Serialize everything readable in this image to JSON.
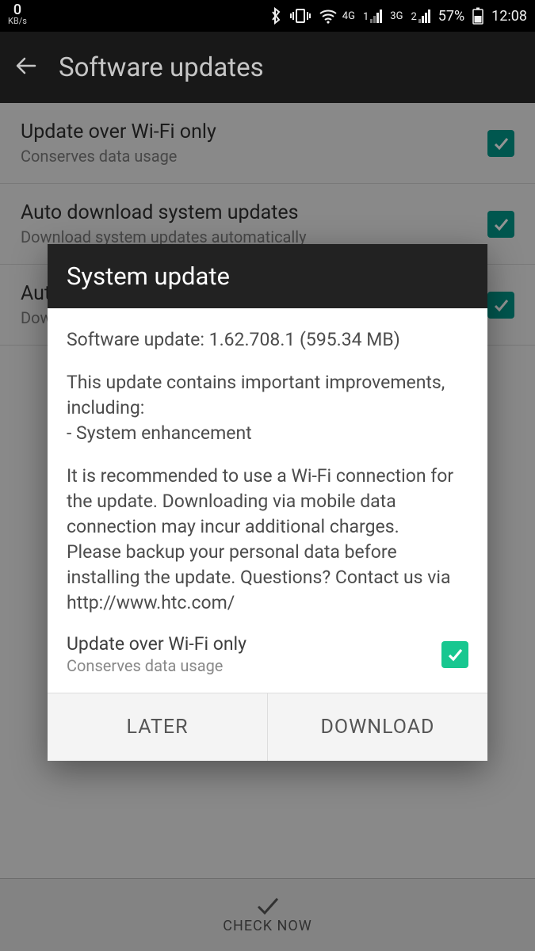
{
  "statusbar": {
    "speed": "0",
    "speed_unit": "KB/s",
    "net_label_1": "4G",
    "sim1_prefix": "1",
    "net_label_2": "3G",
    "sim2_prefix": "2",
    "battery_pct": "57%",
    "clock": "12:08"
  },
  "appbar": {
    "title": "Software updates"
  },
  "settings": [
    {
      "title": "Update over Wi-Fi only",
      "subtitle": "Conserves data usage",
      "checked": true
    },
    {
      "title": "Auto download system updates",
      "subtitle": "Download system updates automatically",
      "checked": true
    },
    {
      "title": "Auto",
      "subtitle": "Down",
      "checked": true
    }
  ],
  "checknow_label": "CHECK NOW",
  "dialog": {
    "title": "System update",
    "line_version": "Software update: 1.62.708.1 (595.34 MB)",
    "line_intro": "This update contains important improvements, including:",
    "line_item": "- System enhancement",
    "line_rec": "It is recommended to use a Wi-Fi connection for the update. Downloading via mobile data connection may incur additional charges.",
    "line_backup": "Please backup your personal data before installing the update. Questions? Contact us via http://www.htc.com/",
    "wifi_title": "Update over Wi-Fi only",
    "wifi_sub": "Conserves data usage",
    "wifi_checked": true,
    "btn_later": "LATER",
    "btn_download": "DOWNLOAD"
  }
}
